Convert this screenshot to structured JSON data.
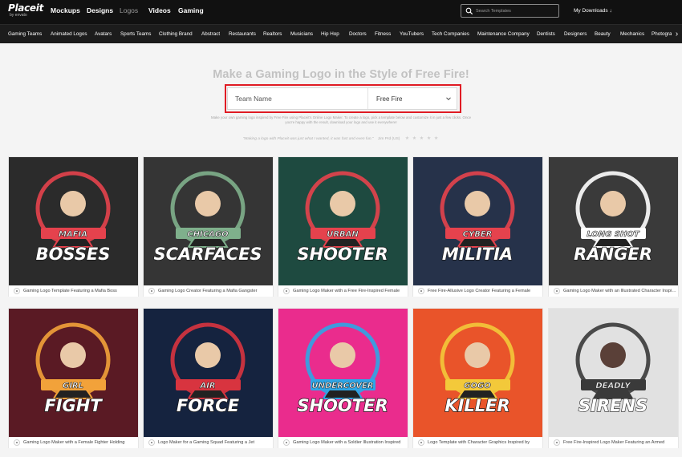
{
  "header": {
    "logo": "Placeit",
    "logo_sub": "by envato",
    "nav": [
      "Mockups",
      "Designs",
      "Logos",
      "Videos",
      "Gaming"
    ],
    "active_nav": "Logos",
    "search_placeholder": "Search Templates",
    "downloads": "My Downloads"
  },
  "categories": [
    "Gaming Teams",
    "Animated Logos",
    "Avatars",
    "Sports Teams",
    "Clothing Brand",
    "Abstract",
    "Restaurants",
    "Realtors",
    "Musicians",
    "Hip Hop",
    "Doctors",
    "Fitness",
    "YouTubers",
    "Tech Companies",
    "Maintenance Company",
    "Dentists",
    "Designers",
    "Beauty",
    "Mechanics",
    "Photogra"
  ],
  "hero": {
    "title": "Make a Gaming Logo in the Style of Free Fire!",
    "team_placeholder": "Team Name",
    "game_value": "Free Fire",
    "description": "Make your own gaming logo inspired by Free Fire using Placeit's Online Logo Maker. To create a logo, pick a template below and customize it in just a few clicks. Once you're happy with the result, download your logo and use it everywhere!",
    "testimonial": "\"Making a logo with Placeit was just what I wanted, it was fast and even fun.\"",
    "testimonial_author": "Jim Prd (US)",
    "stars": "★ ★ ★ ★ ★"
  },
  "colors": {
    "topbar": "#111111",
    "highlight": "#e01b24",
    "title": "#c2c2c2"
  },
  "cards": [
    {
      "title": "Gaming Logo Template Featuring a Mafia Boss",
      "line1": "MAFIA",
      "line2": "BOSSES",
      "bg": "#2b2b2b",
      "icon": "mafia-boss-icon"
    },
    {
      "title": "Gaming Logo Creator Featuring a Mafia Gangster",
      "line1": "CHICAGO",
      "line2": "SCARFACES",
      "bg": "#353535",
      "icon": "gangster-icon"
    },
    {
      "title": "Gaming Logo Maker with a Free Fire-Inspired Female",
      "line1": "URBAN",
      "line2": "SHOOTER",
      "bg": "#1e4a40",
      "icon": "female-shooter-icon"
    },
    {
      "title": "Free Fire-Allusive Logo Creator Featuring a Female",
      "line1": "CYBER",
      "line2": "MILITIA",
      "bg": "#26324a",
      "icon": "cyber-girl-icon"
    },
    {
      "title": "Gaming Logo Maker with an Illustrated Character Inspired",
      "line1": "LONG SHOT",
      "line2": "RANGER",
      "bg": "#3a3a3a",
      "icon": "ranger-icon"
    },
    {
      "title": "Gaming Logo Maker with a Female Fighter Holding",
      "line1": "GIRL",
      "line2": "FIGHT",
      "bg": "#5a1a24",
      "icon": "female-fighter-icon"
    },
    {
      "title": "Logo Maker for a Gaming Squad Featuring a Jet",
      "line1": "AIR",
      "line2": "FORCE",
      "bg": "#15233f",
      "icon": "jet-icon"
    },
    {
      "title": "Gaming Logo Maker with a Soldier Illustration Inspired",
      "line1": "UNDERCOVER",
      "line2": "SHOOTER",
      "bg": "#ea2c8d",
      "icon": "soldier-icon"
    },
    {
      "title": "Logo Template with Character Graphics Inspired by",
      "line1": "GOGO",
      "line2": "KILLER",
      "bg": "#e9542a",
      "icon": "gogo-character-icon"
    },
    {
      "title": "Free Fire-Inspired Logo Maker Featuring an Armed",
      "line1": "DEADLY",
      "line2": "SIRENS",
      "bg": "#e1e1e1",
      "icon": "siren-icon"
    }
  ]
}
